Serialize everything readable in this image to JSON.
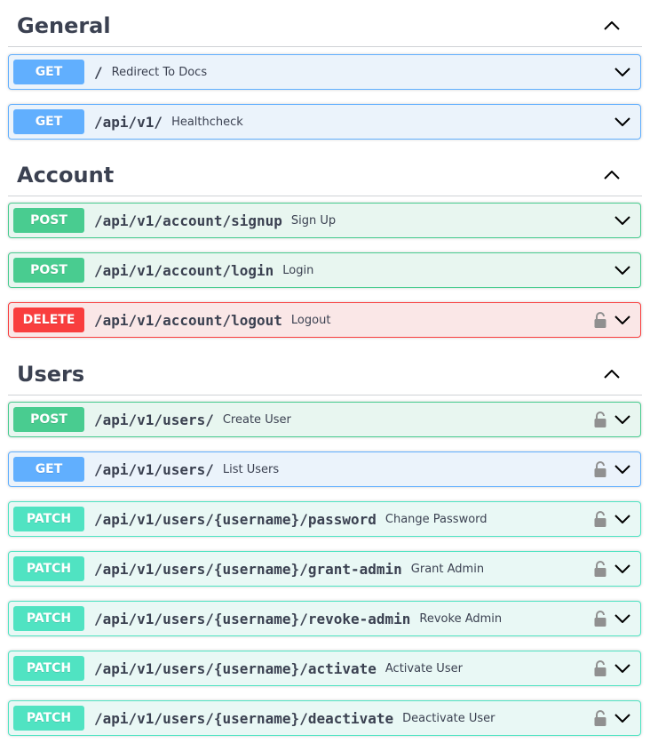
{
  "sections": [
    {
      "title": "General",
      "ops": [
        {
          "method": "GET",
          "path": "/",
          "summary": "Redirect To Docs",
          "locked": false
        },
        {
          "method": "GET",
          "path": "/api/v1/",
          "summary": "Healthcheck",
          "locked": false
        }
      ]
    },
    {
      "title": "Account",
      "ops": [
        {
          "method": "POST",
          "path": "/api/v1/account/signup",
          "summary": "Sign Up",
          "locked": false
        },
        {
          "method": "POST",
          "path": "/api/v1/account/login",
          "summary": "Login",
          "locked": false
        },
        {
          "method": "DELETE",
          "path": "/api/v1/account/logout",
          "summary": "Logout",
          "locked": true
        }
      ]
    },
    {
      "title": "Users",
      "ops": [
        {
          "method": "POST",
          "path": "/api/v1/users/",
          "summary": "Create User",
          "locked": true
        },
        {
          "method": "GET",
          "path": "/api/v1/users/",
          "summary": "List Users",
          "locked": true
        },
        {
          "method": "PATCH",
          "path": "/api/v1/users/{username}/password",
          "summary": "Change Password",
          "locked": true
        },
        {
          "method": "PATCH",
          "path": "/api/v1/users/{username}/grant-admin",
          "summary": "Grant Admin",
          "locked": true
        },
        {
          "method": "PATCH",
          "path": "/api/v1/users/{username}/revoke-admin",
          "summary": "Revoke Admin",
          "locked": true
        },
        {
          "method": "PATCH",
          "path": "/api/v1/users/{username}/activate",
          "summary": "Activate User",
          "locked": true
        },
        {
          "method": "PATCH",
          "path": "/api/v1/users/{username}/deactivate",
          "summary": "Deactivate User",
          "locked": true
        }
      ]
    }
  ],
  "colors": {
    "get": "#61affe",
    "post": "#49cc90",
    "delete": "#f93e3e",
    "patch": "#50e3c2"
  },
  "icons": {
    "section_toggle": "chevron-up-icon",
    "op_expand": "chevron-down-icon",
    "auth": "lock-icon"
  }
}
